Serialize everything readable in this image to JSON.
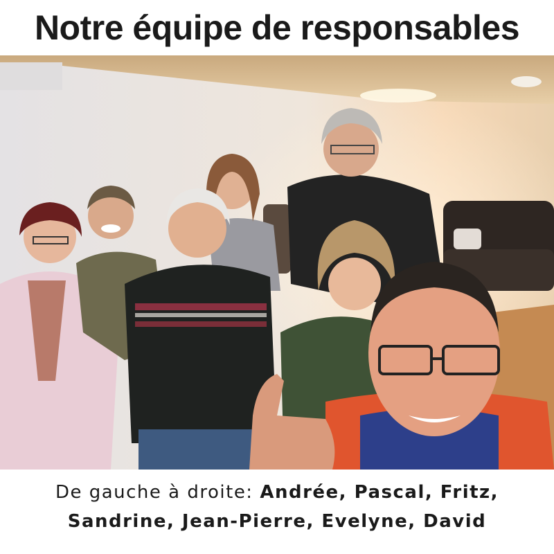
{
  "title": "Notre équipe de responsables",
  "caption": {
    "prefix": "De gauche à droite: ",
    "names_line1": "Andrée, Pascal, Fritz,",
    "names_line2": "Sandrine, Jean-Pierre, Evelyne, David"
  },
  "photo": {
    "subject": "group-selfie",
    "colors": {
      "wall": "#e9e3dc",
      "ceiling": "#d9b98a",
      "floor": "#c89058",
      "sofa": "#2b2420"
    }
  }
}
